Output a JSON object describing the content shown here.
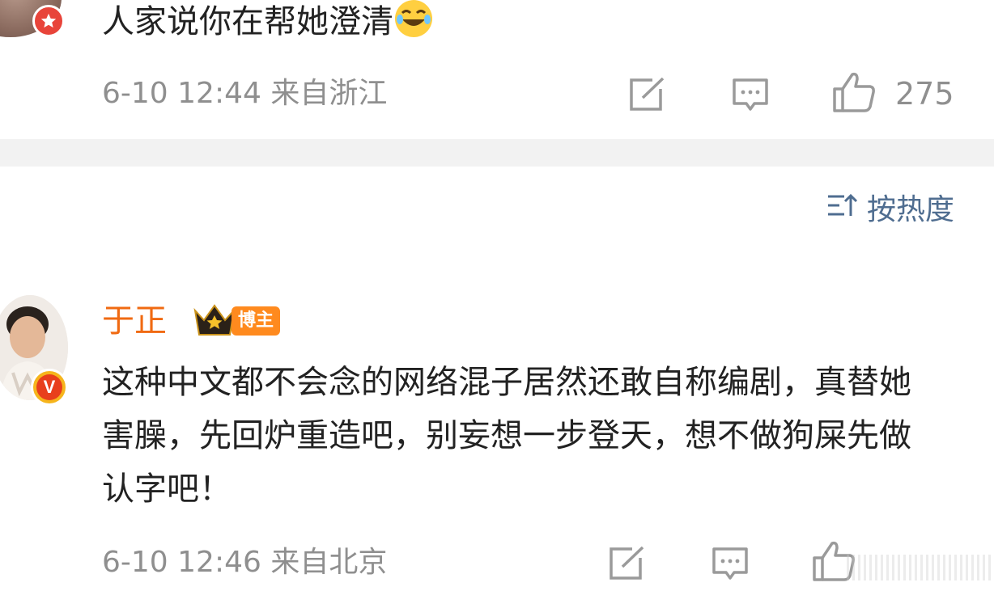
{
  "comments": [
    {
      "text": "人家说你在帮她澄清",
      "emoji": "laughing-tears-emoji",
      "badge_icon": "star-badge-icon",
      "meta": "6-10 12:44 来自浙江",
      "likes": "275"
    },
    {
      "user": "于正",
      "role_badge": "博主",
      "verified_icon": "verified-v-icon",
      "text": "这种中文都不会念的网络混子居然还敢自称编剧，真替她害臊，先回炉重造吧，别妄想一步登天，想不做狗屎先做认字吧！",
      "meta": "6-10 12:46 来自北京"
    }
  ],
  "sort": {
    "icon": "sort-icon",
    "label": "按热度"
  },
  "colors": {
    "meta_gray": "#8f8f8f",
    "username_orange": "#f06a12",
    "sort_blue": "#4f6d90",
    "badge_orange": "#ff8a1e",
    "verified_red": "#e83f1c"
  }
}
